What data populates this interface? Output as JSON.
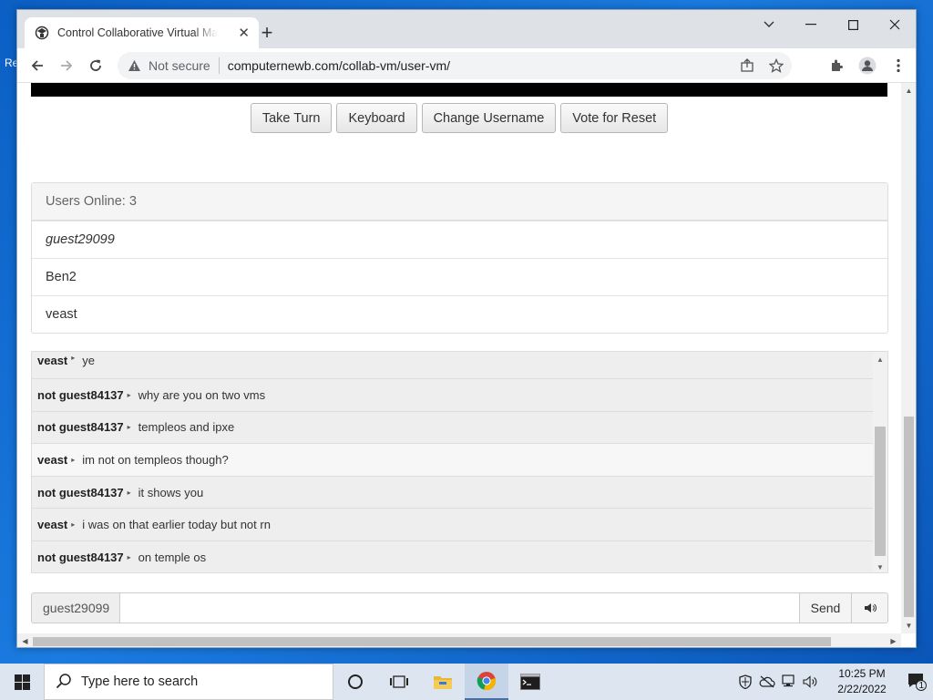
{
  "browser": {
    "tab_title": "Control Collaborative Virtual Machine",
    "not_secure": "Not secure",
    "url": "computernewb.com/collab-vm/user-vm/"
  },
  "desktop": {
    "stub_label": "Re"
  },
  "vm": {
    "buttons": [
      "Take Turn",
      "Keyboard",
      "Change Username",
      "Vote for Reset"
    ]
  },
  "users": {
    "header": "Users Online: 3",
    "list": [
      "guest29099",
      "Ben2",
      "veast"
    ]
  },
  "chat": {
    "messages": [
      {
        "user": "veast",
        "text": "ye"
      },
      {
        "user": "not guest84137",
        "text": "why are you on two vms"
      },
      {
        "user": "not guest84137",
        "text": "templeos and ipxe"
      },
      {
        "user": "veast",
        "text": "im not on templeos though?"
      },
      {
        "user": "not guest84137",
        "text": "it shows you"
      },
      {
        "user": "veast",
        "text": "i was on that earlier today but not rn"
      },
      {
        "user": "not guest84137",
        "text": "on temple os"
      }
    ],
    "username": "guest29099",
    "input_value": "",
    "send_label": "Send"
  },
  "taskbar": {
    "search_placeholder": "Type here to search",
    "time": "10:25 PM",
    "date": "2/22/2022",
    "notification_count": "1"
  },
  "colors": {
    "desktop": "#0b5fc4",
    "taskbar": "#dde6f0"
  }
}
